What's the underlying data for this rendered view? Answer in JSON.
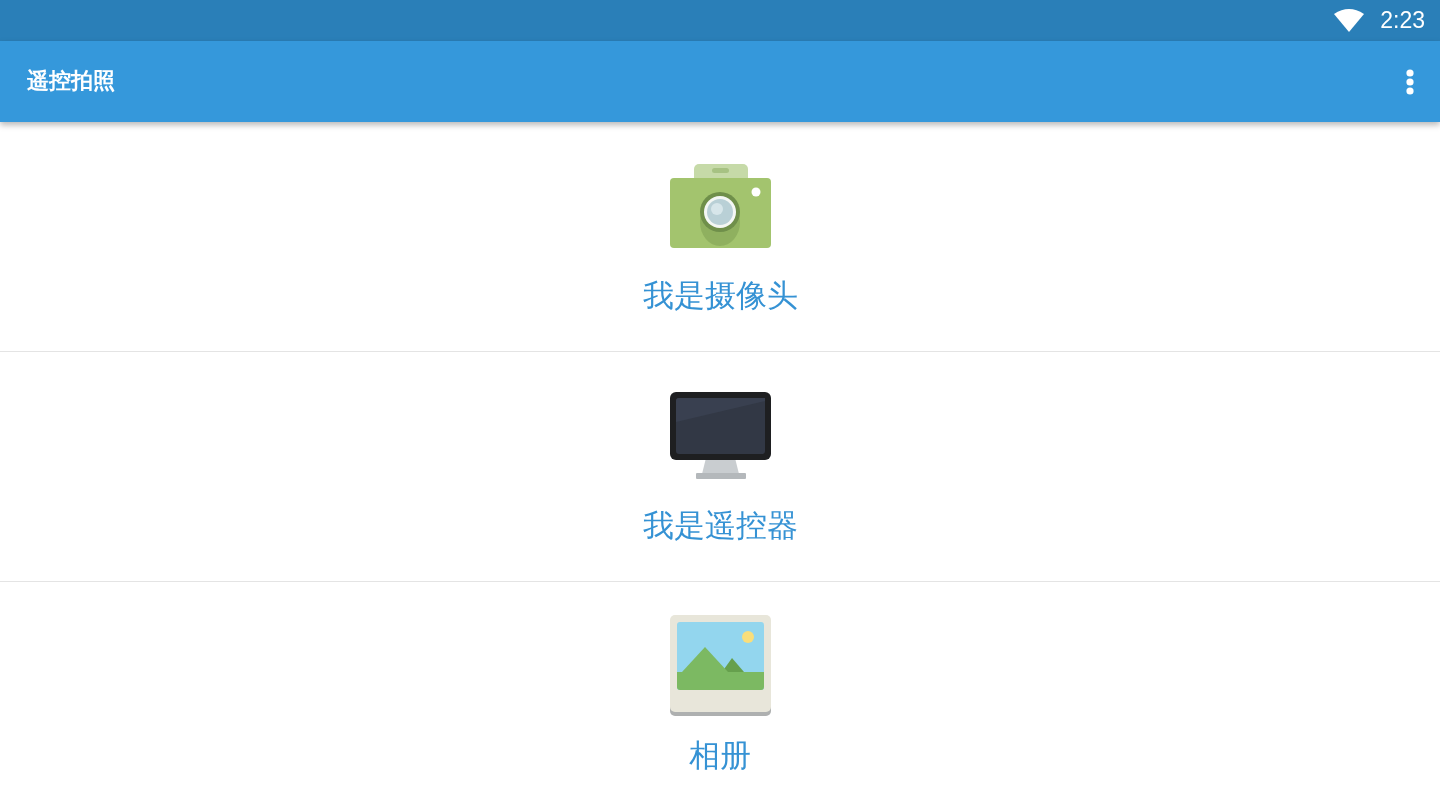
{
  "status_bar": {
    "time": "2:23"
  },
  "app_bar": {
    "title": "遥控拍照"
  },
  "menu_items": [
    {
      "kind": "camera",
      "label": "我是摄像头"
    },
    {
      "kind": "monitor",
      "label": "我是遥控器"
    },
    {
      "kind": "album",
      "label": "相册"
    }
  ]
}
